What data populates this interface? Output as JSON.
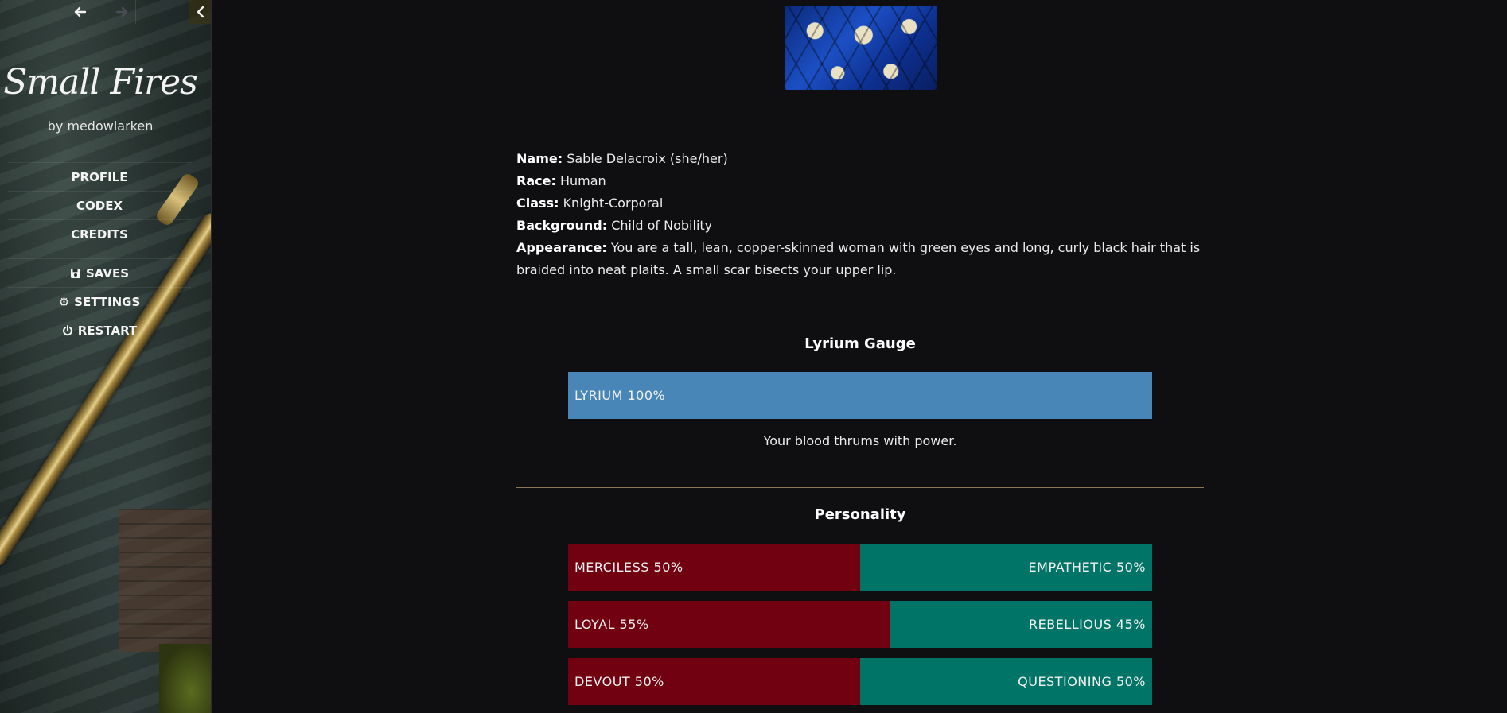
{
  "sidebar": {
    "nav": {
      "back_icon": "arrow-left-icon",
      "forward_icon": "arrow-right-icon",
      "collapse_icon": "chevron-left-icon"
    },
    "story_title": "Small Fires",
    "author": "by medowlarken",
    "story_menu": [
      "PROFILE",
      "CODEX",
      "CREDITS"
    ],
    "system_menu": [
      {
        "label": "SAVES",
        "icon": "save-icon"
      },
      {
        "label": "SETTINGS",
        "icon": "gear-icon"
      },
      {
        "label": "RESTART",
        "icon": "power-icon"
      }
    ]
  },
  "profile": {
    "bio": [
      {
        "label": "Name:",
        "value": "Sable Delacroix (she/her)"
      },
      {
        "label": "Race:",
        "value": "Human"
      },
      {
        "label": "Class:",
        "value": "Knight-Corporal"
      },
      {
        "label": "Background:",
        "value": "Child of Nobility"
      },
      {
        "label": "Appearance:",
        "value": "You are a tall, lean, copper-skinned woman with green eyes and long, curly black hair that is braided into neat plaits. A small scar bisects your upper lip."
      }
    ],
    "lyrium": {
      "title": "Lyrium Gauge",
      "bar_label": "LYRIUM 100%",
      "level": 100,
      "note": "Your blood thrums with power."
    },
    "personality": {
      "title": "Personality",
      "traits": [
        {
          "left_label": "MERCILESS 50%",
          "right_label": "EMPATHETIC 50%",
          "left_pct": 50
        },
        {
          "left_label": "LOYAL 55%",
          "right_label": "REBELLIOUS 45%",
          "left_pct": 55
        },
        {
          "left_label": "DEVOUT 50%",
          "right_label": "QUESTIONING 50%",
          "left_pct": 50
        }
      ]
    }
  },
  "colors": {
    "background": "#0f0e11",
    "lyrium": "#4786b7",
    "trait_left": "#710010",
    "trait_right": "#007567",
    "divider": "#8c7654"
  }
}
